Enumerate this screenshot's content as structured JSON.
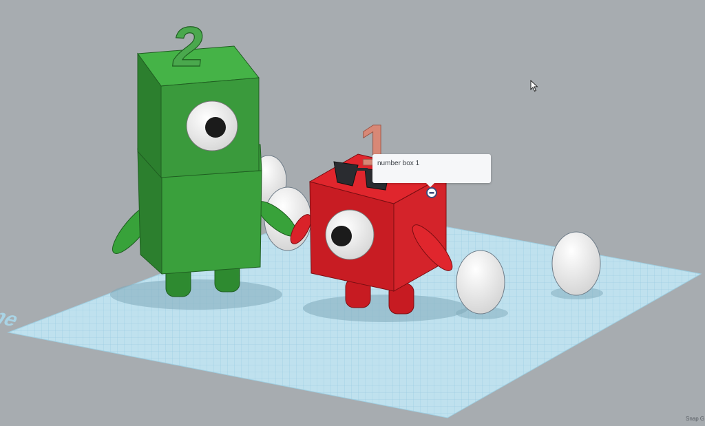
{
  "tooltip": {
    "label": "number box 1"
  },
  "workplane": {
    "label": "Workplane"
  },
  "status": {
    "snap_label": "Snap G"
  },
  "figures": {
    "green": {
      "number": "2",
      "color": "#3a9a3c"
    },
    "red": {
      "number": "1",
      "color": "#d81f26"
    }
  },
  "colors": {
    "background": "#a7acb0",
    "grid": "#bfe1ee",
    "grid_line": "#8fc6dd"
  }
}
